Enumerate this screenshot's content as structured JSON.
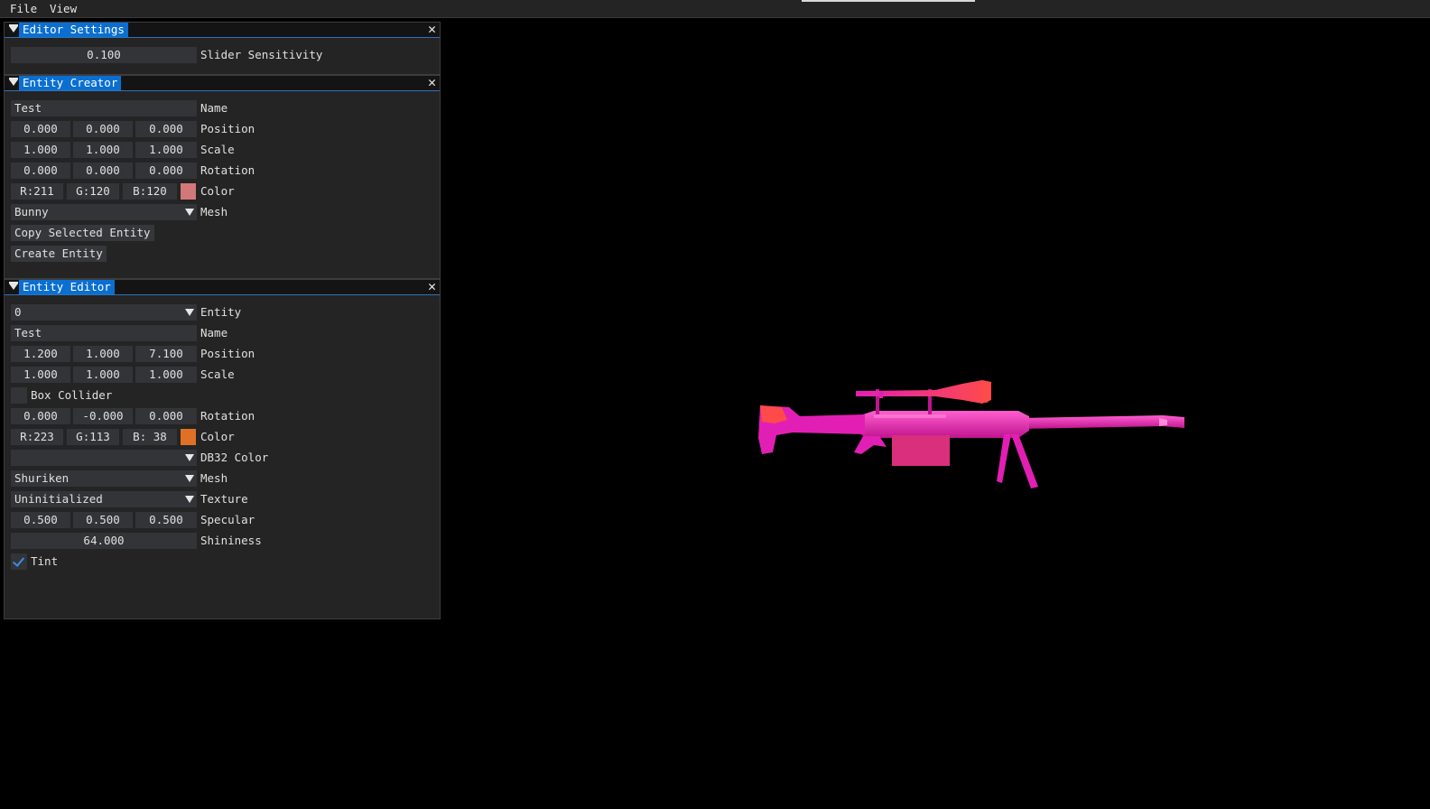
{
  "menubar": {
    "items": [
      {
        "label": "File"
      },
      {
        "label": "View"
      }
    ]
  },
  "editor_settings": {
    "title": "Editor Settings",
    "slider_sensitivity": {
      "value": "0.100",
      "label": "Slider Sensitivity"
    }
  },
  "entity_creator": {
    "title": "Entity Creator",
    "name": {
      "value": "Test",
      "label": "Name"
    },
    "position": {
      "values": [
        "0.000",
        "0.000",
        "0.000"
      ],
      "label": "Position"
    },
    "scale": {
      "values": [
        "1.000",
        "1.000",
        "1.000"
      ],
      "label": "Scale"
    },
    "rotation": {
      "values": [
        "0.000",
        "0.000",
        "0.000"
      ],
      "label": "Rotation"
    },
    "color": {
      "values": [
        "R:211",
        "G:120",
        "B:120"
      ],
      "label": "Color",
      "swatch": "#d37878"
    },
    "mesh": {
      "value": "Bunny",
      "label": "Mesh"
    },
    "copy_button": "Copy Selected Entity",
    "create_button": "Create Entity"
  },
  "entity_editor": {
    "title": "Entity Editor",
    "entity": {
      "value": "0",
      "label": "Entity"
    },
    "name": {
      "value": "Test",
      "label": "Name"
    },
    "position": {
      "values": [
        "1.200",
        "1.000",
        "7.100"
      ],
      "label": "Position"
    },
    "scale": {
      "values": [
        "1.000",
        "1.000",
        "1.000"
      ],
      "label": "Scale"
    },
    "box_collider": {
      "label": "Box Collider",
      "checked": false
    },
    "rotation": {
      "values": [
        "0.000",
        "-0.000",
        "0.000"
      ],
      "label": "Rotation"
    },
    "color": {
      "values": [
        "R:223",
        "G:113",
        "B: 38"
      ],
      "label": "Color",
      "swatch": "#df7126"
    },
    "db32_color": {
      "value": "",
      "label": "DB32 Color"
    },
    "mesh": {
      "value": "Shuriken",
      "label": "Mesh"
    },
    "texture": {
      "value": "Uninitialized",
      "label": "Texture"
    },
    "specular": {
      "values": [
        "0.500",
        "0.500",
        "0.500"
      ],
      "label": "Specular"
    },
    "shininess": {
      "value": "64.000",
      "label": "Shininess"
    },
    "tint": {
      "label": "Tint",
      "checked": true
    }
  },
  "viewport": {
    "model": "sniper-rifle",
    "colors": {
      "body": "#e21fb4",
      "highlight": "#ff4f7a",
      "stock": "#ff4a4a",
      "magazine": "#d92f7c"
    }
  }
}
